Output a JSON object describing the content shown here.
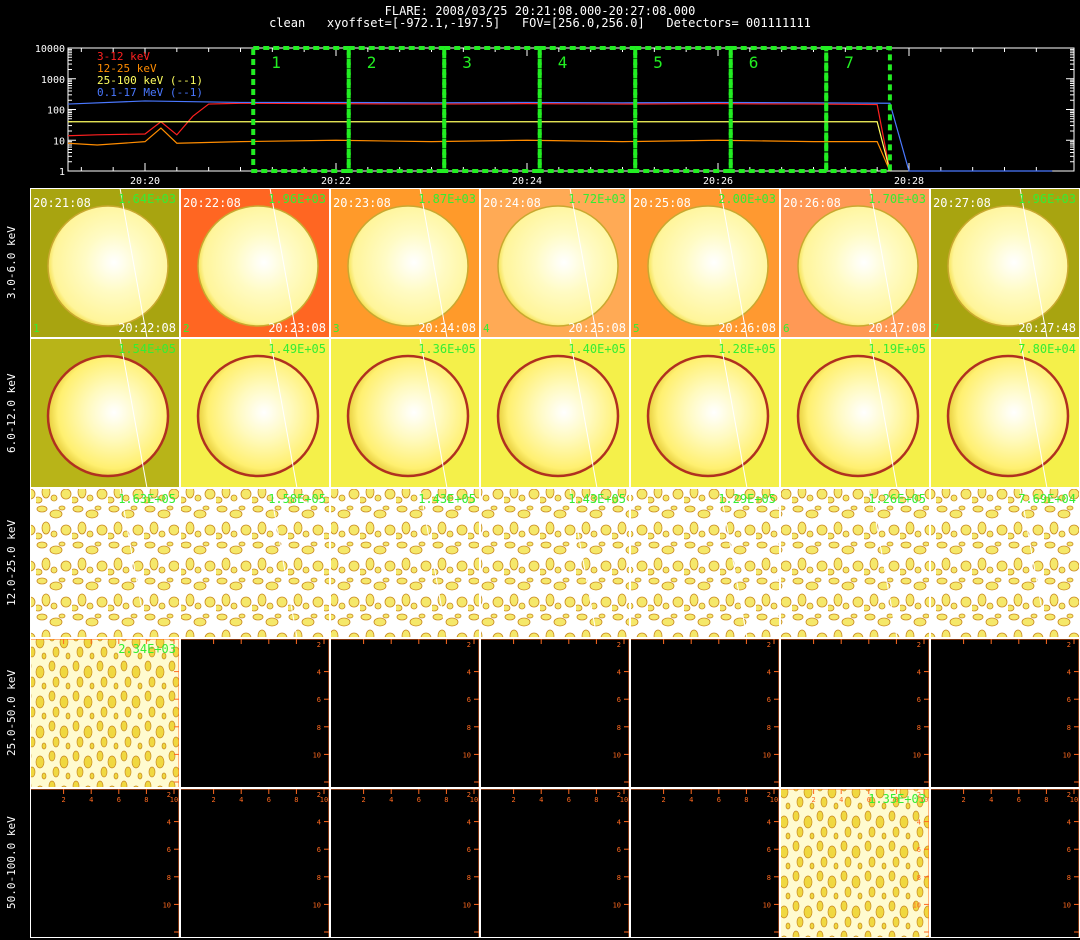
{
  "header": {
    "line1": "FLARE: 2008/03/25 20:21:08.000-20:27:08.000",
    "line2": "clean   xyoffset=[-972.1,-197.5]   FOV=[256.0,256.0]   Detectors= 001111111"
  },
  "chart_data": [
    {
      "type": "line",
      "scale": "log",
      "ylim": [
        1,
        10000
      ],
      "yticks": [
        "10000",
        "1000",
        "100",
        "10",
        "1"
      ],
      "xticks": [
        "20:20",
        "20:22",
        "20:24",
        "20:26",
        "20:28"
      ],
      "legend": [
        {
          "label": "3-12 keV",
          "color": "#ff2020"
        },
        {
          "label": "12-25 keV",
          "color": "#ff8c00"
        },
        {
          "label": "25-100 keV (--1)",
          "color": "#ffff60"
        },
        {
          "label": "0.1-17 MeV (--1)",
          "color": "#4a78ff"
        }
      ],
      "series": [
        {
          "name": "3-12 keV",
          "color": "#ff2020",
          "x": [
            "20:19:00",
            "20:19:30",
            "20:20:00",
            "20:20:10",
            "20:20:20",
            "20:20:30",
            "20:20:40",
            "20:21:00",
            "20:22:00",
            "20:23:00",
            "20:24:00",
            "20:25:00",
            "20:26:00",
            "20:27:00",
            "20:27:40",
            "20:27:48"
          ],
          "values": [
            14,
            15,
            16,
            40,
            15,
            60,
            150,
            160,
            155,
            150,
            155,
            150,
            155,
            150,
            145,
            1
          ]
        },
        {
          "name": "12-25 keV",
          "color": "#ff8c00",
          "x": [
            "20:19:00",
            "20:19:30",
            "20:20:00",
            "20:20:10",
            "20:20:20",
            "20:21:00",
            "20:22:00",
            "20:23:00",
            "20:24:00",
            "20:25:00",
            "20:26:00",
            "20:27:00",
            "20:27:40",
            "20:27:48"
          ],
          "values": [
            8,
            7,
            9,
            25,
            8,
            9,
            10,
            9,
            10,
            9,
            10,
            9,
            9,
            1
          ]
        },
        {
          "name": "25-100 keV (--1)",
          "color": "#ffff60",
          "x": [
            "20:19:00",
            "20:20:00",
            "20:21:00",
            "20:22:00",
            "20:23:00",
            "20:24:00",
            "20:25:00",
            "20:26:00",
            "20:27:00",
            "20:27:40",
            "20:27:48"
          ],
          "values": [
            40,
            40,
            40,
            40,
            40,
            40,
            40,
            40,
            40,
            40,
            1
          ]
        },
        {
          "name": "0.1-17 MeV (--1)",
          "color": "#4a78ff",
          "x": [
            "20:19:00",
            "20:20:00",
            "20:21:00",
            "20:22:00",
            "20:23:00",
            "20:24:00",
            "20:25:00",
            "20:26:00",
            "20:27:00",
            "20:27:48",
            "20:28:00",
            "20:29:30"
          ],
          "values": [
            150,
            190,
            170,
            170,
            165,
            170,
            165,
            170,
            165,
            160,
            1,
            1
          ]
        }
      ],
      "intervals": [
        {
          "label": "1",
          "start": "20:21:08",
          "end": "20:22:08"
        },
        {
          "label": "2",
          "start": "20:22:08",
          "end": "20:23:08"
        },
        {
          "label": "3",
          "start": "20:23:08",
          "end": "20:24:08"
        },
        {
          "label": "4",
          "start": "20:24:08",
          "end": "20:25:08"
        },
        {
          "label": "5",
          "start": "20:25:08",
          "end": "20:26:08"
        },
        {
          "label": "6",
          "start": "20:26:08",
          "end": "20:27:08"
        },
        {
          "label": "7",
          "start": "20:27:08",
          "end": "20:27:48"
        }
      ]
    },
    {
      "type": "heatmap",
      "rows": [
        "3.0-6.0 keV",
        "6.0-12.0 keV",
        "12.0-25.0 keV",
        "25.0-50.0 keV",
        "50.0-100.0 keV"
      ],
      "columns": [
        "1",
        "2",
        "3",
        "4",
        "5",
        "6",
        "7"
      ],
      "start_times": [
        "20:21:08",
        "20:22:08",
        "20:23:08",
        "20:24:08",
        "20:25:08",
        "20:26:08",
        "20:27:08"
      ],
      "end_times": [
        "20:22:08",
        "20:23:08",
        "20:24:08",
        "20:25:08",
        "20:26:08",
        "20:27:08",
        "20:27:48"
      ],
      "peaks": [
        [
          "1.64E+03",
          "1.96E+03",
          "1.87E+03",
          "1.72E+03",
          "2.00E+03",
          "1.70E+03",
          "1.96E+03"
        ],
        [
          "1.54E+05",
          "1.49E+05",
          "1.36E+05",
          "1.40E+05",
          "1.28E+05",
          "1.19E+05",
          "7.80E+04"
        ],
        [
          "1.63E+05",
          "1.58E+05",
          "1.43E+05",
          "1.43E+05",
          "1.29E+05",
          "1.26E+05",
          "7.69E+04"
        ],
        [
          "2.34E+03",
          "",
          "",
          "",
          "",
          "",
          ""
        ],
        [
          "",
          "",
          "",
          "",
          "",
          "1.35E+03",
          ""
        ]
      ],
      "axis_ticks": [
        "2",
        "4",
        "6",
        "8",
        "10"
      ],
      "panel_backgrounds": [
        [
          "#a8a410",
          "#ff6622",
          "#ff9a2a",
          "#ffaa55",
          "#ff9930",
          "#ff9955",
          "#a8a410"
        ],
        [
          "#b8b418",
          "#f4f04a",
          "#f4f04a",
          "#f4f04a",
          "#f4f04a",
          "#f4f04a",
          "#f4f04a"
        ]
      ]
    }
  ]
}
